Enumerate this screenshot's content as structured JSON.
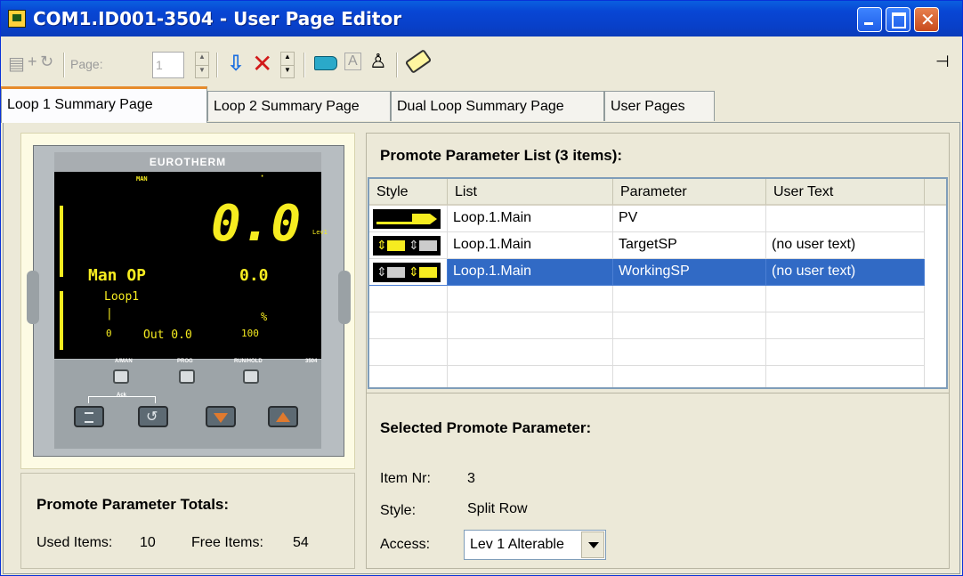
{
  "window": {
    "title": "COM1.ID001-3504 - User Page Editor"
  },
  "toolbar": {
    "page_label": "Page:",
    "page_value": "1"
  },
  "tabs": [
    {
      "label": "Loop 1 Summary Page",
      "active": true
    },
    {
      "label": "Loop 2 Summary Page",
      "active": false
    },
    {
      "label": "Dual Loop Summary Page",
      "active": false
    },
    {
      "label": "User Pages",
      "active": false
    }
  ],
  "device": {
    "brand": "EUROTHERM",
    "mode_top": "MAN",
    "pv_value": "0.0",
    "level": "Lev1",
    "op_label": "Man OP",
    "op_value": "0.0",
    "loop_name": "Loop1",
    "unit": "%",
    "scale_low": "0",
    "out_label": "Out 0.0",
    "scale_high": "100",
    "key_labels": [
      "A/MAN",
      "PROG",
      "RUN/HOLD"
    ],
    "model": "3504",
    "ack_label": "Ack"
  },
  "totals": {
    "title": "Promote Parameter Totals:",
    "used_label": "Used Items:",
    "used_value": "10",
    "free_label": "Free Items:",
    "free_value": "54"
  },
  "promote_list": {
    "title": "Promote Parameter List (3 items):",
    "columns": [
      "Style",
      "List",
      "Parameter",
      "User Text"
    ],
    "rows": [
      {
        "style": "bar-graph-icon",
        "list": "Loop.1.Main",
        "parameter": "PV",
        "user_text": "",
        "selected": false
      },
      {
        "style": "split-row-icon",
        "list": "Loop.1.Main",
        "parameter": "TargetSP",
        "user_text": "(no user text)",
        "selected": false
      },
      {
        "style": "split-row-icon",
        "list": "Loop.1.Main",
        "parameter": "WorkingSP",
        "user_text": "(no user text)",
        "selected": true
      }
    ]
  },
  "selected": {
    "title": "Selected Promote Parameter:",
    "item_label": "Item Nr:",
    "item_value": "3",
    "style_label": "Style:",
    "style_value": "Split Row",
    "access_label": "Access:",
    "access_value": "Lev 1 Alterable"
  }
}
